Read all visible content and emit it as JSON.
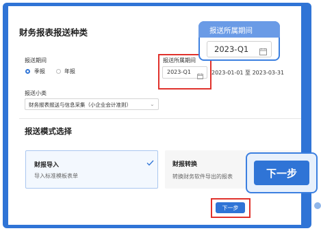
{
  "section1": {
    "title": "财务报表报送种类",
    "period_label": "报送期间",
    "period_options": [
      "季报",
      "年报"
    ],
    "selected_period": "季报",
    "belong_label": "报送所属期间",
    "belong_value": "2023-Q1",
    "date_range": "2023-01-01 至 2023-03-31",
    "subclass_label": "报送小类",
    "subclass_value": "财务报表报送与信息采集（小企业会计准则）"
  },
  "section2": {
    "title": "报送模式选择",
    "cards": [
      {
        "title": "财报导入",
        "desc": "导入标准模板表单",
        "selected": true
      },
      {
        "title": "财报转换",
        "desc": "转换财务软件导出的报表",
        "selected": false
      }
    ]
  },
  "next_button": "下一步",
  "callouts": {
    "period": {
      "label": "报送所属期间",
      "value": "2023-Q1"
    },
    "next": {
      "label": "下一步"
    }
  },
  "colors": {
    "accent": "#2f74d6",
    "highlight": "#e0302a"
  }
}
